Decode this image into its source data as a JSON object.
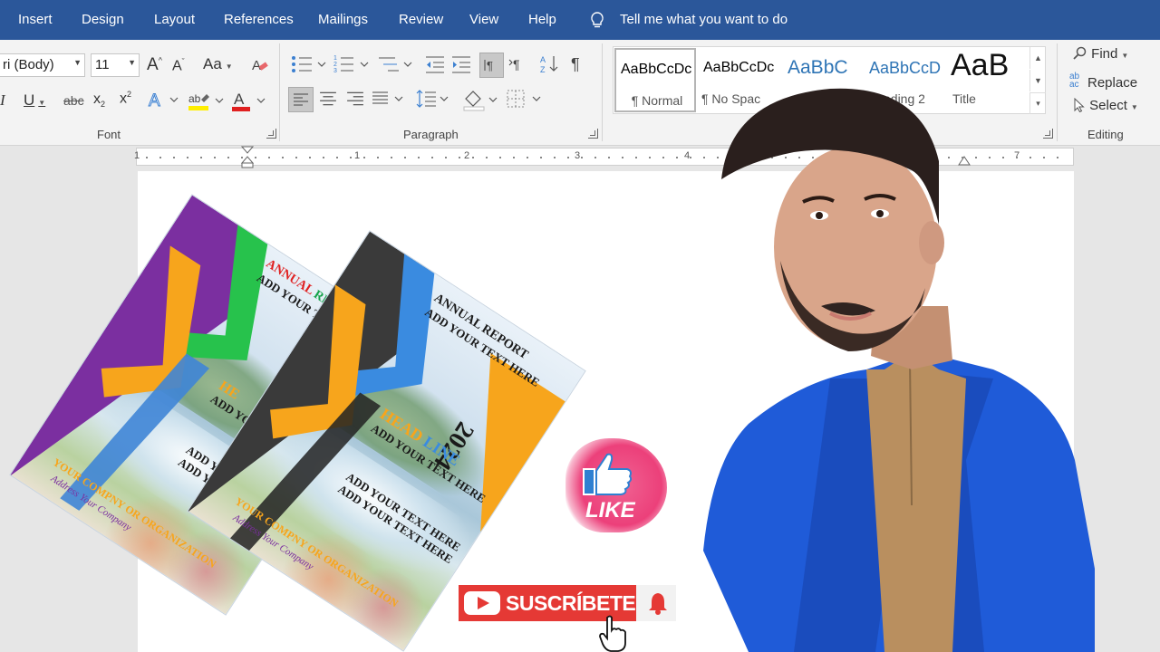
{
  "tabs": [
    "Insert",
    "Design",
    "Layout",
    "References",
    "Mailings",
    "Review",
    "View",
    "Help"
  ],
  "tell_me": "Tell me what you want to do",
  "font": {
    "name": "ri (Body)",
    "size": "11",
    "grow": "A",
    "shrink": "A",
    "case": "Aa",
    "italic": "I",
    "underline": "U",
    "strike": "abc",
    "subscript": "x",
    "superscript": "x",
    "group_label": "Font"
  },
  "paragraph": {
    "group_label": "Paragraph"
  },
  "styles": [
    {
      "preview": "AaBbCcDc",
      "name": "¶ Normal"
    },
    {
      "preview": "AaBbCcDc",
      "name": "¶ No Spac"
    },
    {
      "preview": "AaBbC",
      "name": ""
    },
    {
      "preview": "AaBbCcD",
      "name": "ading 2"
    },
    {
      "preview": "AaB",
      "name": "Title"
    }
  ],
  "editing": {
    "find": "Find",
    "replace": "Replace",
    "select": "Select",
    "group_label": "Editing"
  },
  "ruler": [
    "1",
    "1",
    "2",
    "3",
    "4",
    "7"
  ],
  "cover_back": {
    "title_a": "ANNUAL",
    "title_b": "REPORT",
    "line1": "ADD YOUR TEXT HERE",
    "headline": "HE",
    "line2": "ADD YOU",
    "line3": "ADD YO",
    "line4": "ADD YO",
    "company": "YOUR COMPNY OR ORGANIZATION",
    "address": "Address Your Company"
  },
  "cover_front": {
    "title": "ANNUAL REPORT",
    "line1": "ADD YOUR TEXT HERE",
    "year": "2024",
    "head": "HEAD",
    "line_word": "LINE",
    "line2": "ADD YOUR TEXT HERE",
    "line3": "ADD YOUR TEXT HERE",
    "line4": "ADD YOUR TEXT HERE",
    "company": "YOUR COMPNY OR ORGANIZATION",
    "address": "Address Your Company"
  },
  "like": "LIKE",
  "subscribe": "SUSCRÍBETE",
  "colors": {
    "word_blue": "#2b579a",
    "youtube_red": "#e53935",
    "like_pink": "#ec407a"
  }
}
